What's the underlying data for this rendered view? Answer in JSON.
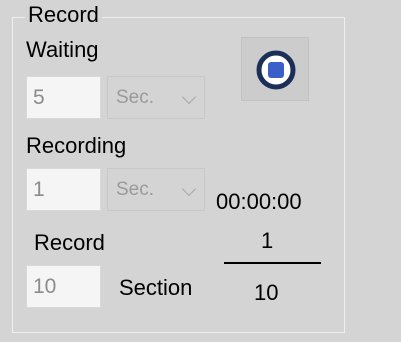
{
  "group": {
    "title": "Record"
  },
  "waiting": {
    "label": "Waiting",
    "value": "5",
    "unit": "Sec."
  },
  "recording": {
    "label": "Recording",
    "value": "1",
    "unit": "Sec."
  },
  "record": {
    "label": "Record",
    "value": "10",
    "suffix": "Section"
  },
  "timer": {
    "elapsed": "00:00:00"
  },
  "progress": {
    "current": "1",
    "total": "10"
  },
  "icons": {
    "stop_button": "stop-circle-icon"
  },
  "colors": {
    "stop_icon_ring": "#1c2f57",
    "stop_icon_fill": "#3a5fc8"
  }
}
